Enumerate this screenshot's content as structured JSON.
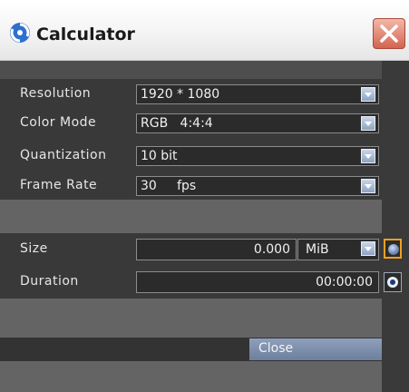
{
  "window": {
    "title": "Calculator"
  },
  "settings": [
    {
      "label": "Resolution",
      "value": "1920 * 1080"
    },
    {
      "label": "Color Mode",
      "value": "RGB   4:4:4"
    },
    {
      "label": "Quantization",
      "value": "10 bit"
    },
    {
      "label": "Frame Rate",
      "value": "30     fps"
    }
  ],
  "size": {
    "label": "Size",
    "value": "0.000",
    "unit": "MiB"
  },
  "duration": {
    "label": "Duration",
    "value": "00:00:00"
  },
  "footer": {
    "close_label": "Close"
  },
  "colors": {
    "accent": "#f0a020",
    "panel": "#393939",
    "button": "#7f91ad"
  },
  "icons": {
    "app": "calculator-app-icon",
    "close": "close-icon",
    "dropdown": "chevron-down-icon",
    "radio": "radio-icon"
  }
}
